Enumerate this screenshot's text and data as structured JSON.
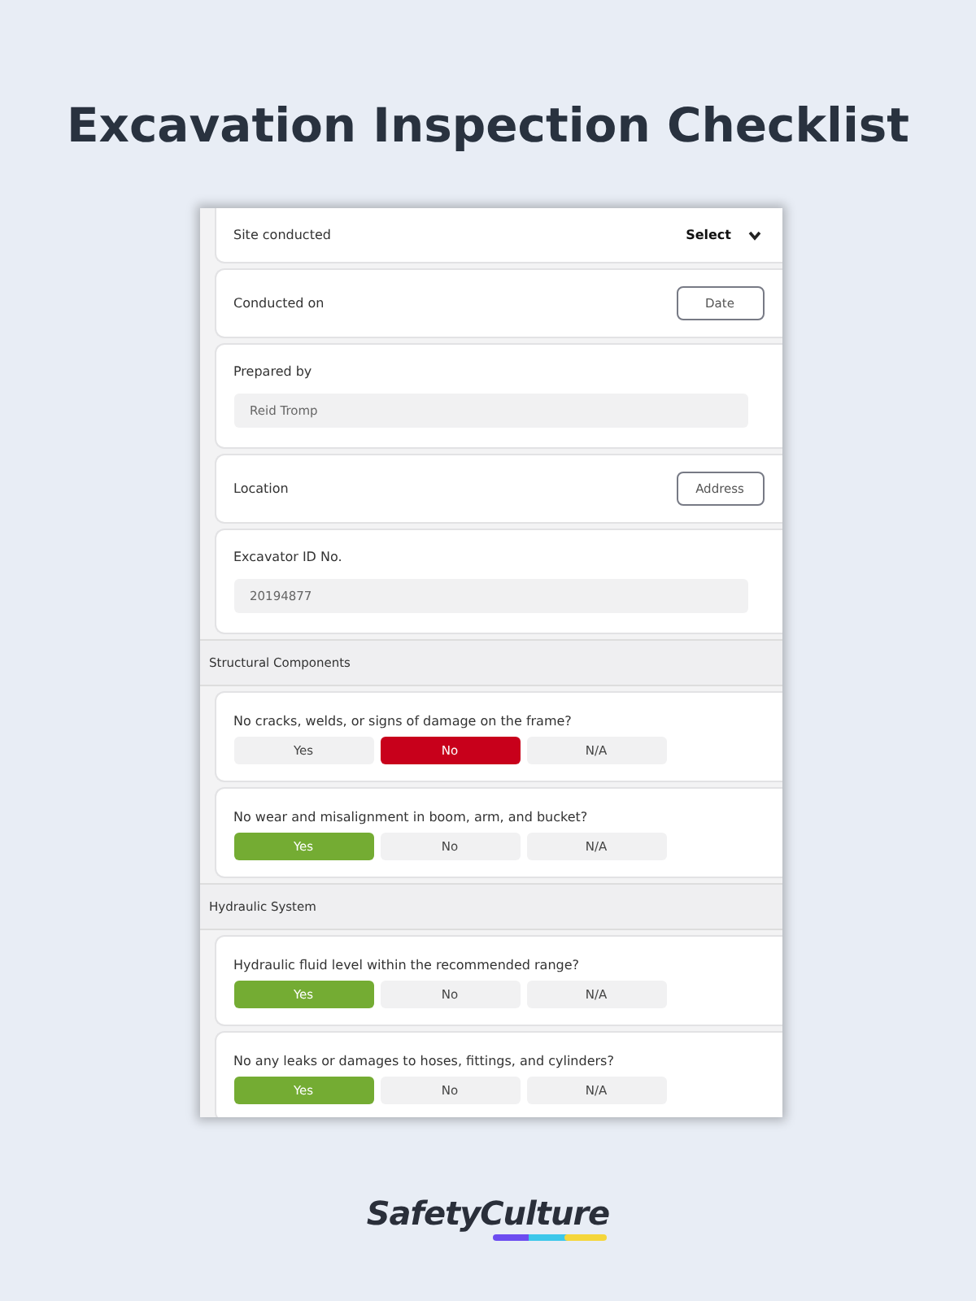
{
  "heading": "Excavation Inspection Checklist",
  "fields": [
    {
      "kind": "select",
      "label": "Site conducted",
      "value": "Select"
    },
    {
      "kind": "button",
      "label": "Conducted on",
      "value": "Date"
    },
    {
      "kind": "text",
      "label": "Prepared by",
      "value": "Reid Tromp"
    },
    {
      "kind": "button",
      "label": "Location",
      "value": "Address"
    },
    {
      "kind": "text",
      "label": "Excavator ID No.",
      "value": "20194877"
    }
  ],
  "sections": [
    {
      "title": "Structural Components",
      "questions": [
        {
          "text": "No cracks, welds, or signs of damage on the frame?",
          "options": [
            {
              "label": "Yes",
              "kind": "yes",
              "selected": false
            },
            {
              "label": "No",
              "kind": "no",
              "selected": true
            },
            {
              "label": "N/A",
              "kind": "na",
              "selected": false
            }
          ]
        },
        {
          "text": "No wear and misalignment in boom, arm, and bucket?",
          "options": [
            {
              "label": "Yes",
              "kind": "yes",
              "selected": true
            },
            {
              "label": "No",
              "kind": "no",
              "selected": false
            },
            {
              "label": "N/A",
              "kind": "na",
              "selected": false
            }
          ]
        }
      ]
    },
    {
      "title": "Hydraulic System",
      "questions": [
        {
          "text": "Hydraulic fluid level within the recommended range?",
          "options": [
            {
              "label": "Yes",
              "kind": "yes",
              "selected": true
            },
            {
              "label": "No",
              "kind": "no",
              "selected": false
            },
            {
              "label": "N/A",
              "kind": "na",
              "selected": false
            }
          ]
        },
        {
          "text": "No any leaks or damages to hoses, fittings, and cylinders?",
          "options": [
            {
              "label": "Yes",
              "kind": "yes",
              "selected": true
            },
            {
              "label": "No",
              "kind": "no",
              "selected": false
            },
            {
              "label": "N/A",
              "kind": "na",
              "selected": false
            }
          ]
        }
      ]
    }
  ],
  "brand": "SafetyCulture"
}
